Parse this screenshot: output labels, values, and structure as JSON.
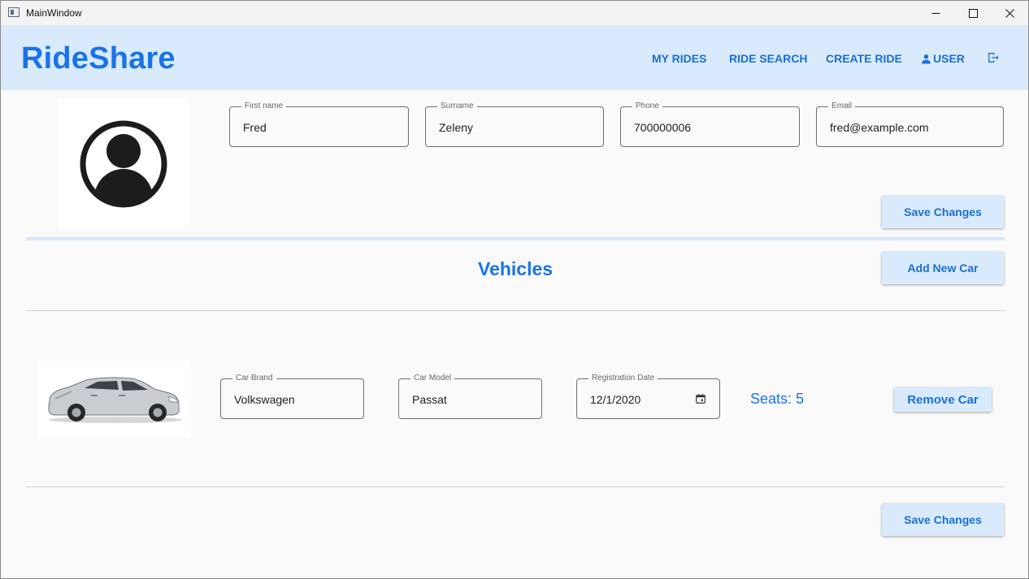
{
  "window": {
    "title": "MainWindow"
  },
  "header": {
    "brand": "RideShare",
    "nav": {
      "my_rides": "MY RIDES",
      "ride_search": "RIDE SEARCH",
      "create_ride": "CREATE RIDE",
      "user": "USER"
    },
    "icons": {
      "user": "person-icon",
      "logout": "logout-icon"
    }
  },
  "profile": {
    "first_name": {
      "label": "First name",
      "value": "Fred"
    },
    "surname": {
      "label": "Surname",
      "value": "Zeleny"
    },
    "phone": {
      "label": "Phone",
      "value": "700000006"
    },
    "email": {
      "label": "Email",
      "value": "fred@example.com"
    },
    "save_label": "Save Changes"
  },
  "vehicles": {
    "title": "Vehicles",
    "add_label": "Add New Car",
    "cars": [
      {
        "brand": {
          "label": "Car Brand",
          "value": "Volkswagen"
        },
        "model": {
          "label": "Car Model",
          "value": "Passat"
        },
        "registration": {
          "label": "Registration Date",
          "value": "12/1/2020"
        },
        "seats": "Seats: 5",
        "remove_label": "Remove Car"
      }
    ],
    "save_label": "Save Changes"
  },
  "colors": {
    "accent": "#1a73e8",
    "appbar": "#d9eafd",
    "button_bg": "#d9eafd",
    "button_text": "#1a6fd6"
  }
}
